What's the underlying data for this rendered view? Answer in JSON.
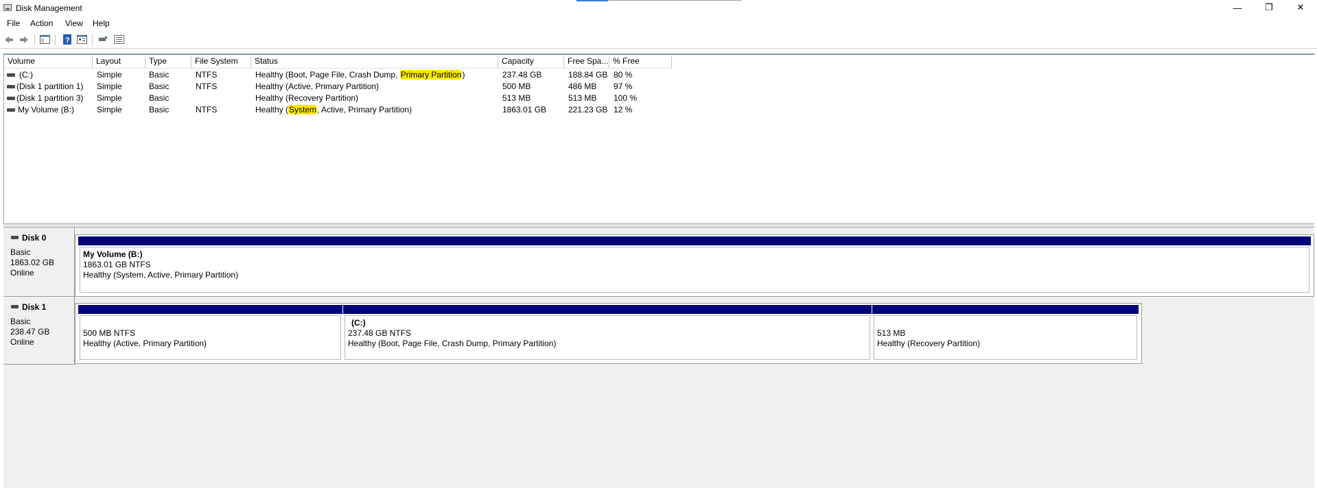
{
  "window": {
    "title": "Disk Management",
    "minimize_glyph": "—",
    "restore_glyph": "❐",
    "close_glyph": "✕"
  },
  "menu": [
    "File",
    "Action",
    "View",
    "Help"
  ],
  "toolbar_icons": [
    "back-arrow-icon",
    "forward-arrow-icon",
    "show-hide-console-tree-icon",
    "help-icon",
    "properties-icon",
    "refresh-icon",
    "settings-list-icon"
  ],
  "volumes_table": {
    "columns": [
      "Volume",
      "Layout",
      "Type",
      "File System",
      "Status",
      "Capacity",
      "Free Spa...",
      "% Free"
    ],
    "rows": [
      {
        "volume": "(C:)",
        "layout": "Simple",
        "type": "Basic",
        "fs": "NTFS",
        "status_pre": "Healthy (Boot, Page File, Crash Dump, ",
        "status_hl": "Primary Partition",
        "status_post": ")",
        "capacity": "237.48 GB",
        "free": "188.84 GB",
        "pct": "80 %"
      },
      {
        "volume": "(Disk 1 partition 1)",
        "layout": "Simple",
        "type": "Basic",
        "fs": "NTFS",
        "status_pre": "Healthy (Active, Primary Partition)",
        "status_hl": "",
        "status_post": "",
        "capacity": "500 MB",
        "free": "486 MB",
        "pct": "97 %"
      },
      {
        "volume": "(Disk 1 partition 3)",
        "layout": "Simple",
        "type": "Basic",
        "fs": "",
        "status_pre": "Healthy (Recovery Partition)",
        "status_hl": "",
        "status_post": "",
        "capacity": "513 MB",
        "free": "513 MB",
        "pct": "100 %"
      },
      {
        "volume": "My Volume (B:)",
        "layout": "Simple",
        "type": "Basic",
        "fs": "NTFS",
        "status_pre": "Healthy (",
        "status_hl": "System",
        "status_post": ", Active, Primary Partition)",
        "capacity": "1863.01 GB",
        "free": "221.23 GB",
        "pct": "12 %"
      }
    ]
  },
  "disks": [
    {
      "name": "Disk 0",
      "type": "Basic",
      "size": "1863.02 GB",
      "state": "Online",
      "partitions": [
        {
          "name": "My Volume  (B:)",
          "size_fs": "1863.01 GB NTFS",
          "status": "Healthy (System, Active, Primary Partition)"
        }
      ]
    },
    {
      "name": "Disk 1",
      "type": "Basic",
      "size": "238.47 GB",
      "state": "Online",
      "partitions": [
        {
          "name": "",
          "size_fs": "500 MB NTFS",
          "status": "Healthy (Active, Primary Partition)"
        },
        {
          "name": "(C:)",
          "size_fs": "237.48 GB NTFS",
          "status": "Healthy (Boot, Page File, Crash Dump, Primary Partition)"
        },
        {
          "name": "",
          "size_fs": "513 MB",
          "status": "Healthy (Recovery Partition)"
        }
      ]
    }
  ],
  "colors": {
    "partition_bar": "#00007b",
    "highlight": "#ffe800",
    "pane_background": "#f0f0f0"
  }
}
